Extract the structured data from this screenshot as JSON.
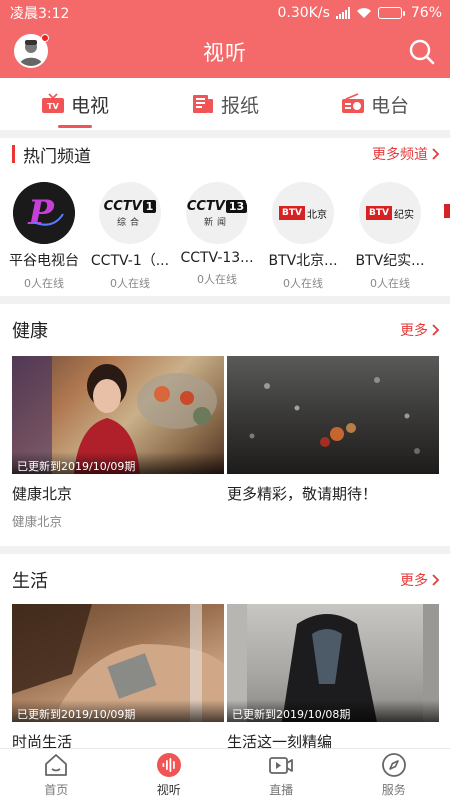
{
  "status_bar": {
    "time": "凌晨3:12",
    "speed": "0.30K/s",
    "battery": "76%",
    "battery_level": 0.76
  },
  "header": {
    "title": "视听"
  },
  "media_tabs": [
    {
      "label": "电视",
      "icon": "tv-icon",
      "active": true
    },
    {
      "label": "报纸",
      "icon": "newspaper-icon",
      "active": false
    },
    {
      "label": "电台",
      "icon": "radio-icon",
      "active": false
    }
  ],
  "hot_channels": {
    "title": "热门频道",
    "more": "更多频道",
    "items": [
      {
        "name": "平谷电视台",
        "online": "0人在线",
        "logo": "pinggu-tv-logo",
        "logo_text": "P"
      },
      {
        "name": "CCTV-1（...",
        "online": "0人在线",
        "logo": "cctv1-logo",
        "logo_text": "CCTV",
        "logo_num": "1",
        "logo_sub": "综合"
      },
      {
        "name": "CCTV-13...",
        "online": "0人在线",
        "logo": "cctv13-logo",
        "logo_text": "CCTV",
        "logo_num": "13",
        "logo_sub": "新闻"
      },
      {
        "name": "BTV北京...",
        "online": "0人在线",
        "logo": "btv-beijing-logo",
        "logo_text": "BTV",
        "logo_sub": "北京"
      },
      {
        "name": "BTV纪实...",
        "online": "0人在线",
        "logo": "btv-documentary-logo",
        "logo_text": "BTV",
        "logo_sub": "纪实"
      }
    ]
  },
  "sections": [
    {
      "title": "健康",
      "more": "更多",
      "cards": [
        {
          "title": "健康北京",
          "subtitle": "健康北京",
          "stamp": "已更新到2019/10/09期"
        },
        {
          "title": "更多精彩，敬请期待！",
          "subtitle": "",
          "stamp": ""
        }
      ]
    },
    {
      "title": "生活",
      "more": "更多",
      "cards": [
        {
          "title": "时尚生活",
          "subtitle": "",
          "stamp": "已更新到2019/10/09期"
        },
        {
          "title": "生活这一刻精编",
          "subtitle": "",
          "stamp": "已更新到2019/10/08期"
        }
      ]
    }
  ],
  "bottom_nav": [
    {
      "label": "首页",
      "icon": "home-icon",
      "active": false
    },
    {
      "label": "视听",
      "icon": "audio-wave-icon",
      "active": true
    },
    {
      "label": "直播",
      "icon": "live-video-icon",
      "active": false
    },
    {
      "label": "服务",
      "icon": "compass-icon",
      "active": false
    }
  ],
  "colors": {
    "brand": "#f46a6a",
    "accent_red": "#e63b3b"
  }
}
